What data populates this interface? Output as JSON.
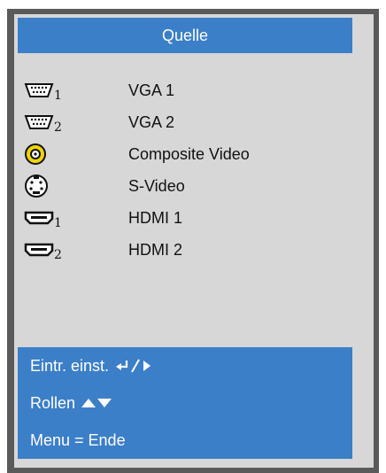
{
  "header": {
    "title": "Quelle"
  },
  "sources": [
    {
      "label": "VGA 1",
      "icon": "vga-icon",
      "sub": "1"
    },
    {
      "label": "VGA 2",
      "icon": "vga-icon",
      "sub": "2"
    },
    {
      "label": "Composite Video",
      "icon": "composite-video-icon",
      "sub": ""
    },
    {
      "label": "S-Video",
      "icon": "s-video-icon",
      "sub": ""
    },
    {
      "label": "HDMI 1",
      "icon": "hdmi-icon",
      "sub": "1"
    },
    {
      "label": "HDMI 2",
      "icon": "hdmi-icon",
      "sub": "2"
    }
  ],
  "footer": {
    "enter": "Eintr. einst.",
    "scroll": "Rollen",
    "menu": "Menu = Ende"
  },
  "colors": {
    "accent": "#3b7fc8",
    "panel": "#d7d7d7",
    "frame": "#5a5a5a",
    "composite_yellow": "#f0d400"
  }
}
